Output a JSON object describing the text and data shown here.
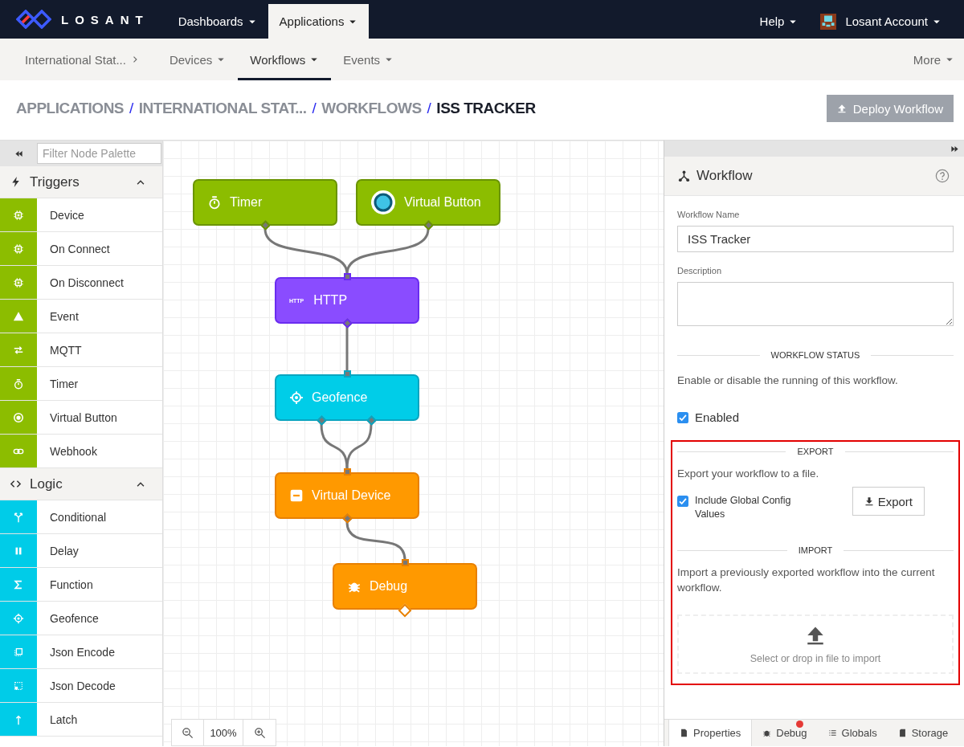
{
  "top_nav": {
    "brand": "LOSANT",
    "items": [
      {
        "label": "Dashboards",
        "selected": false
      },
      {
        "label": "Applications",
        "selected": true
      }
    ],
    "help": "Help",
    "account": "Losant Account"
  },
  "sub_nav": {
    "application": "International Stat...",
    "items": [
      {
        "label": "Devices",
        "selected": false
      },
      {
        "label": "Workflows",
        "selected": true
      },
      {
        "label": "Events",
        "selected": false
      }
    ],
    "more": "More"
  },
  "breadcrumb": [
    {
      "label": "APPLICATIONS",
      "separator": "/",
      "current": false
    },
    {
      "label": "INTERNATIONAL STAT...",
      "separator": "/",
      "current": false
    },
    {
      "label": "WORKFLOWS",
      "separator": "/",
      "current": false
    },
    {
      "label": "ISS TRACKER",
      "current": true
    }
  ],
  "deploy_button": {
    "label": "Deploy Workflow",
    "disabled": true
  },
  "palette": {
    "filter_placeholder": "Filter Node Palette",
    "sections": [
      {
        "title": "Triggers",
        "kind": "triggers",
        "expanded": true,
        "items": [
          "Device",
          "On Connect",
          "On Disconnect",
          "Event",
          "MQTT",
          "Timer",
          "Virtual Button",
          "Webhook"
        ]
      },
      {
        "title": "Logic",
        "kind": "logic",
        "expanded": true,
        "items": [
          "Conditional",
          "Delay",
          "Function",
          "Geofence",
          "Json Encode",
          "Json Decode",
          "Latch"
        ]
      }
    ]
  },
  "canvas": {
    "nodes": [
      {
        "label": "Timer",
        "kind": "trigger"
      },
      {
        "label": "Virtual Button",
        "kind": "trigger"
      },
      {
        "label": "HTTP",
        "kind": "data",
        "icon_text": "HTTP"
      },
      {
        "label": "Geofence",
        "kind": "logic"
      },
      {
        "label": "Virtual Device",
        "kind": "output"
      },
      {
        "label": "Debug",
        "kind": "output"
      }
    ],
    "zoom": "100%"
  },
  "properties": {
    "title": "Workflow",
    "name_label": "Workflow Name",
    "name_value": "ISS Tracker",
    "description_label": "Description",
    "status": {
      "heading": "WORKFLOW STATUS",
      "text": "Enable or disable the running of this workflow.",
      "checkbox": {
        "label": "Enabled",
        "checked": true
      }
    },
    "highlighted": true,
    "export": {
      "heading": "EXPORT",
      "text": "Export your workflow to a file.",
      "checkbox": {
        "label": "Include Global Config Values",
        "checked": true
      },
      "button": "Export"
    },
    "import": {
      "heading": "IMPORT",
      "text": "Import a previously exported workflow into the current workflow.",
      "dropzone": "Select or drop in file to import"
    },
    "tabs": [
      {
        "label": "Properties",
        "selected": true,
        "alert": false
      },
      {
        "label": "Debug",
        "selected": false,
        "alert": true
      },
      {
        "label": "Globals",
        "selected": false,
        "alert": false
      },
      {
        "label": "Storage",
        "selected": false,
        "alert": false
      }
    ]
  }
}
